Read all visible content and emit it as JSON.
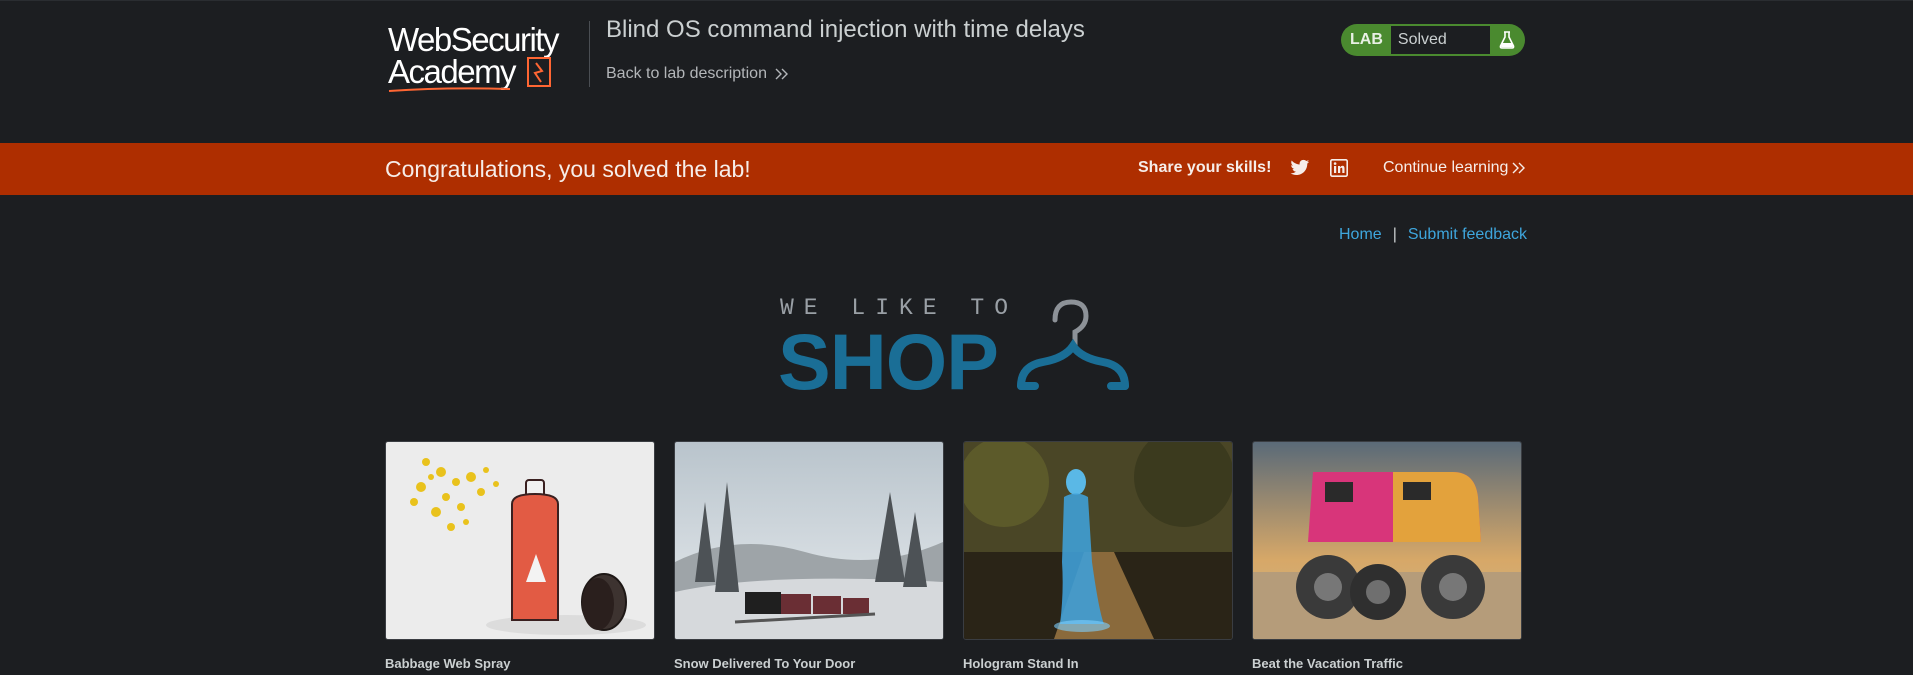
{
  "header": {
    "logo_text_line1": "WebSecurity",
    "logo_text_line2": "Academy",
    "lab_title": "Blind OS command injection with time delays",
    "back_link": "Back to lab description",
    "lab_status": {
      "tag": "LAB",
      "status": "Solved",
      "icon": "flask-icon"
    }
  },
  "banner": {
    "message": "Congratulations, you solved the lab!",
    "share_label": "Share your skills!",
    "social_icons": [
      "twitter-icon",
      "linkedin-icon"
    ],
    "continue_label": "Continue learning"
  },
  "nav": {
    "home": "Home",
    "separator": "|",
    "feedback": "Submit feedback"
  },
  "shop_logo": {
    "tagline": "WE LIKE TO",
    "word": "SHOP",
    "icon": "hanger-icon"
  },
  "products": [
    {
      "name": "Babbage Web Spray"
    },
    {
      "name": "Snow Delivered To Your Door"
    },
    {
      "name": "Hologram Stand In"
    },
    {
      "name": "Beat the Vacation Traffic"
    }
  ],
  "colors": {
    "background": "#1c1e21",
    "banner": "#ae2e00",
    "lab_green": "#4a8a2f",
    "link_blue": "#3ea6dd",
    "shop_blue": "#1a6e96"
  }
}
